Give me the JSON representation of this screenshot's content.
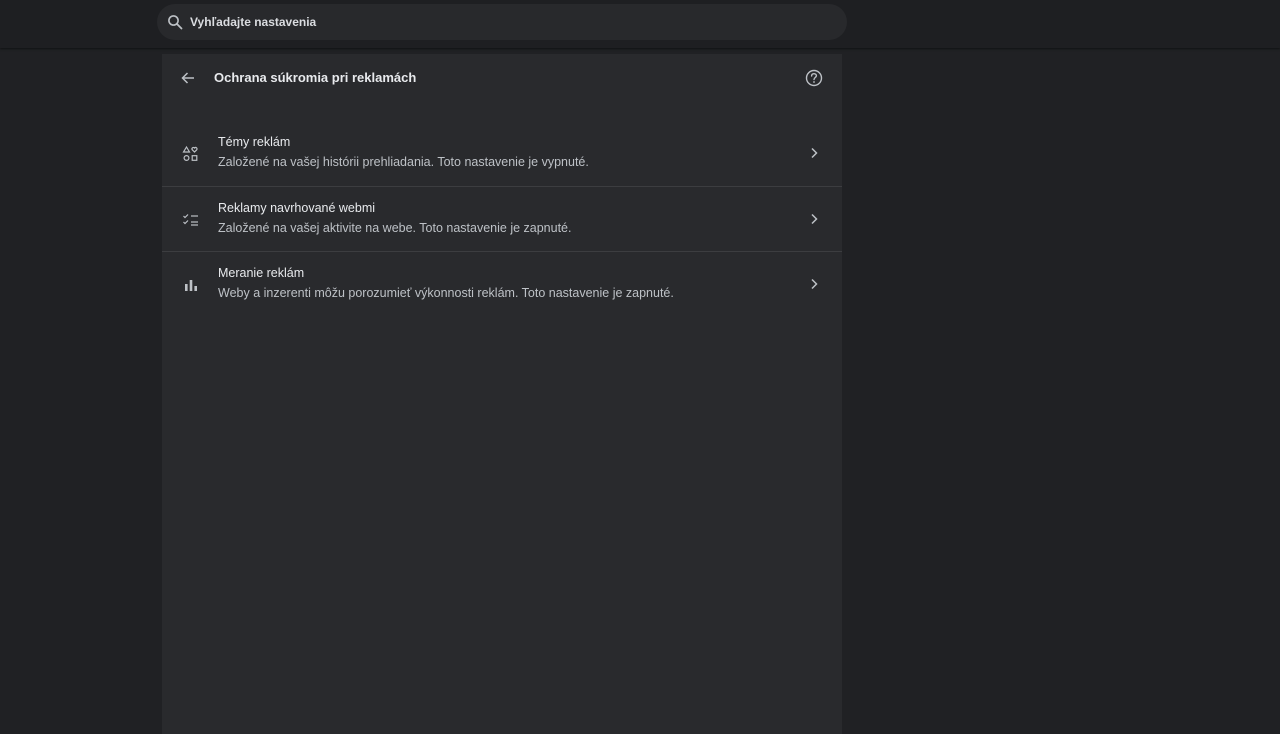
{
  "search": {
    "placeholder": "Vyhľadajte nastavenia",
    "icon": "search-icon"
  },
  "header": {
    "title": "Ochrana súkromia pri reklamách",
    "back_icon": "arrow-back-icon",
    "help_icon": "help-icon"
  },
  "items": [
    {
      "title": "Témy reklám",
      "subtitle": "Založené na vašej histórii prehliadania. Toto nastavenie je vypnuté.",
      "icon": "ad-topics-icon"
    },
    {
      "title": "Reklamy navrhované webmi",
      "subtitle": "Založené na vašej aktivite na webe. Toto nastavenie je zapnuté.",
      "icon": "checklist-icon"
    },
    {
      "title": "Meranie reklám",
      "subtitle": "Weby a inzerenti môžu porozumieť výkonnosti reklám. Toto nastavenie je zapnuté.",
      "icon": "bar-chart-icon"
    }
  ],
  "colors": {
    "background": "#202124",
    "panel": "#292a2d",
    "text_primary": "#e8eaed",
    "text_secondary": "#bdc1c6"
  }
}
